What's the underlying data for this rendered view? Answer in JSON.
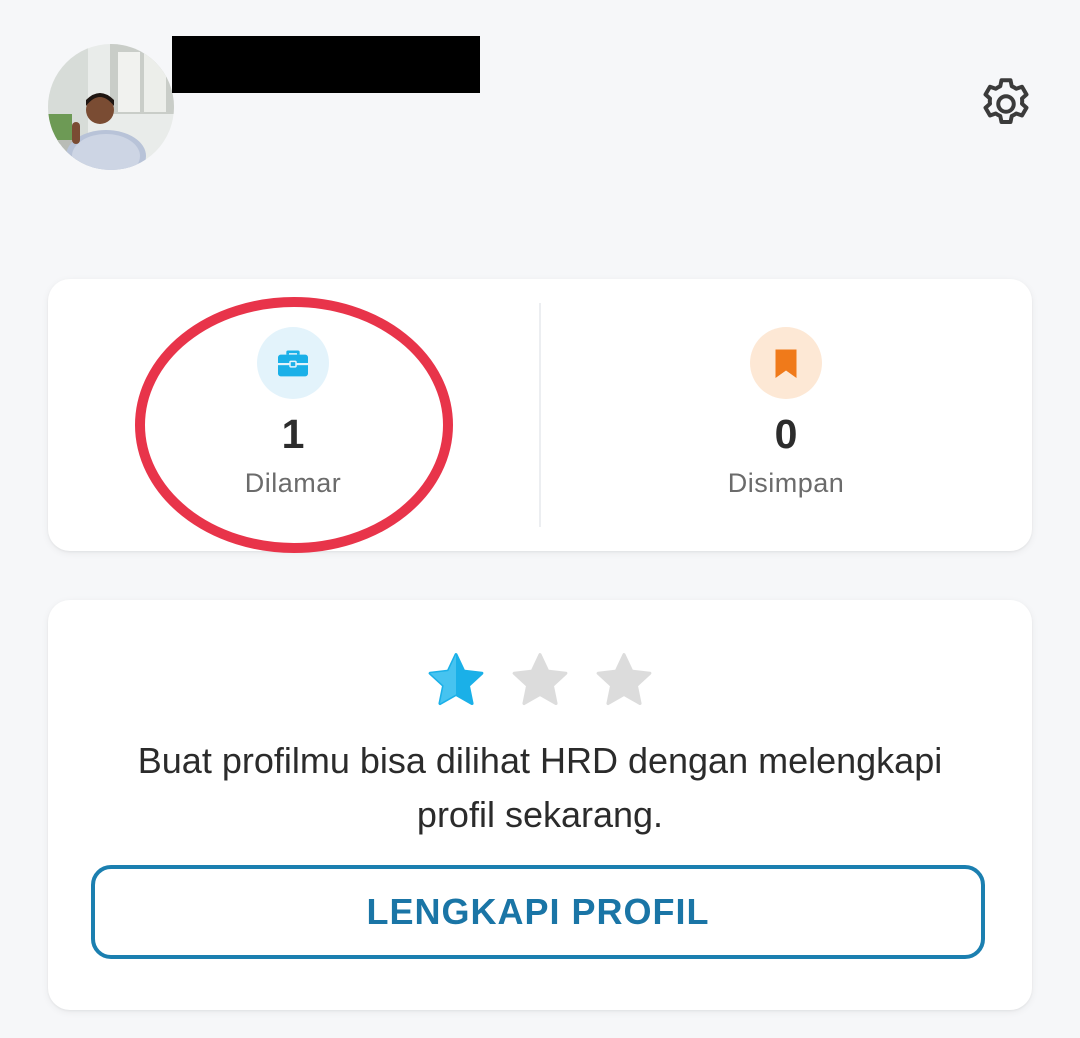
{
  "header": {
    "avatar_icon": "user-photo",
    "settings_icon": "gear-icon"
  },
  "stats": {
    "applied": {
      "count": "1",
      "label": "Dilamar",
      "icon": "briefcase-icon",
      "color": "#1ab0e8"
    },
    "saved": {
      "count": "0",
      "label": "Disimpan",
      "icon": "bookmark-icon",
      "color": "#f07a1a"
    }
  },
  "profile_completion": {
    "rating_filled": 1,
    "rating_total": 3,
    "prompt": "Buat profilmu bisa dilihat HRD dengan melengkapi profil sekarang.",
    "button_label": "LENGKAPI PROFIL"
  },
  "colors": {
    "accent": "#1a75a6",
    "star_filled": "#1ab0e8",
    "star_empty": "#dcdcdc",
    "highlight": "#e8344a"
  }
}
